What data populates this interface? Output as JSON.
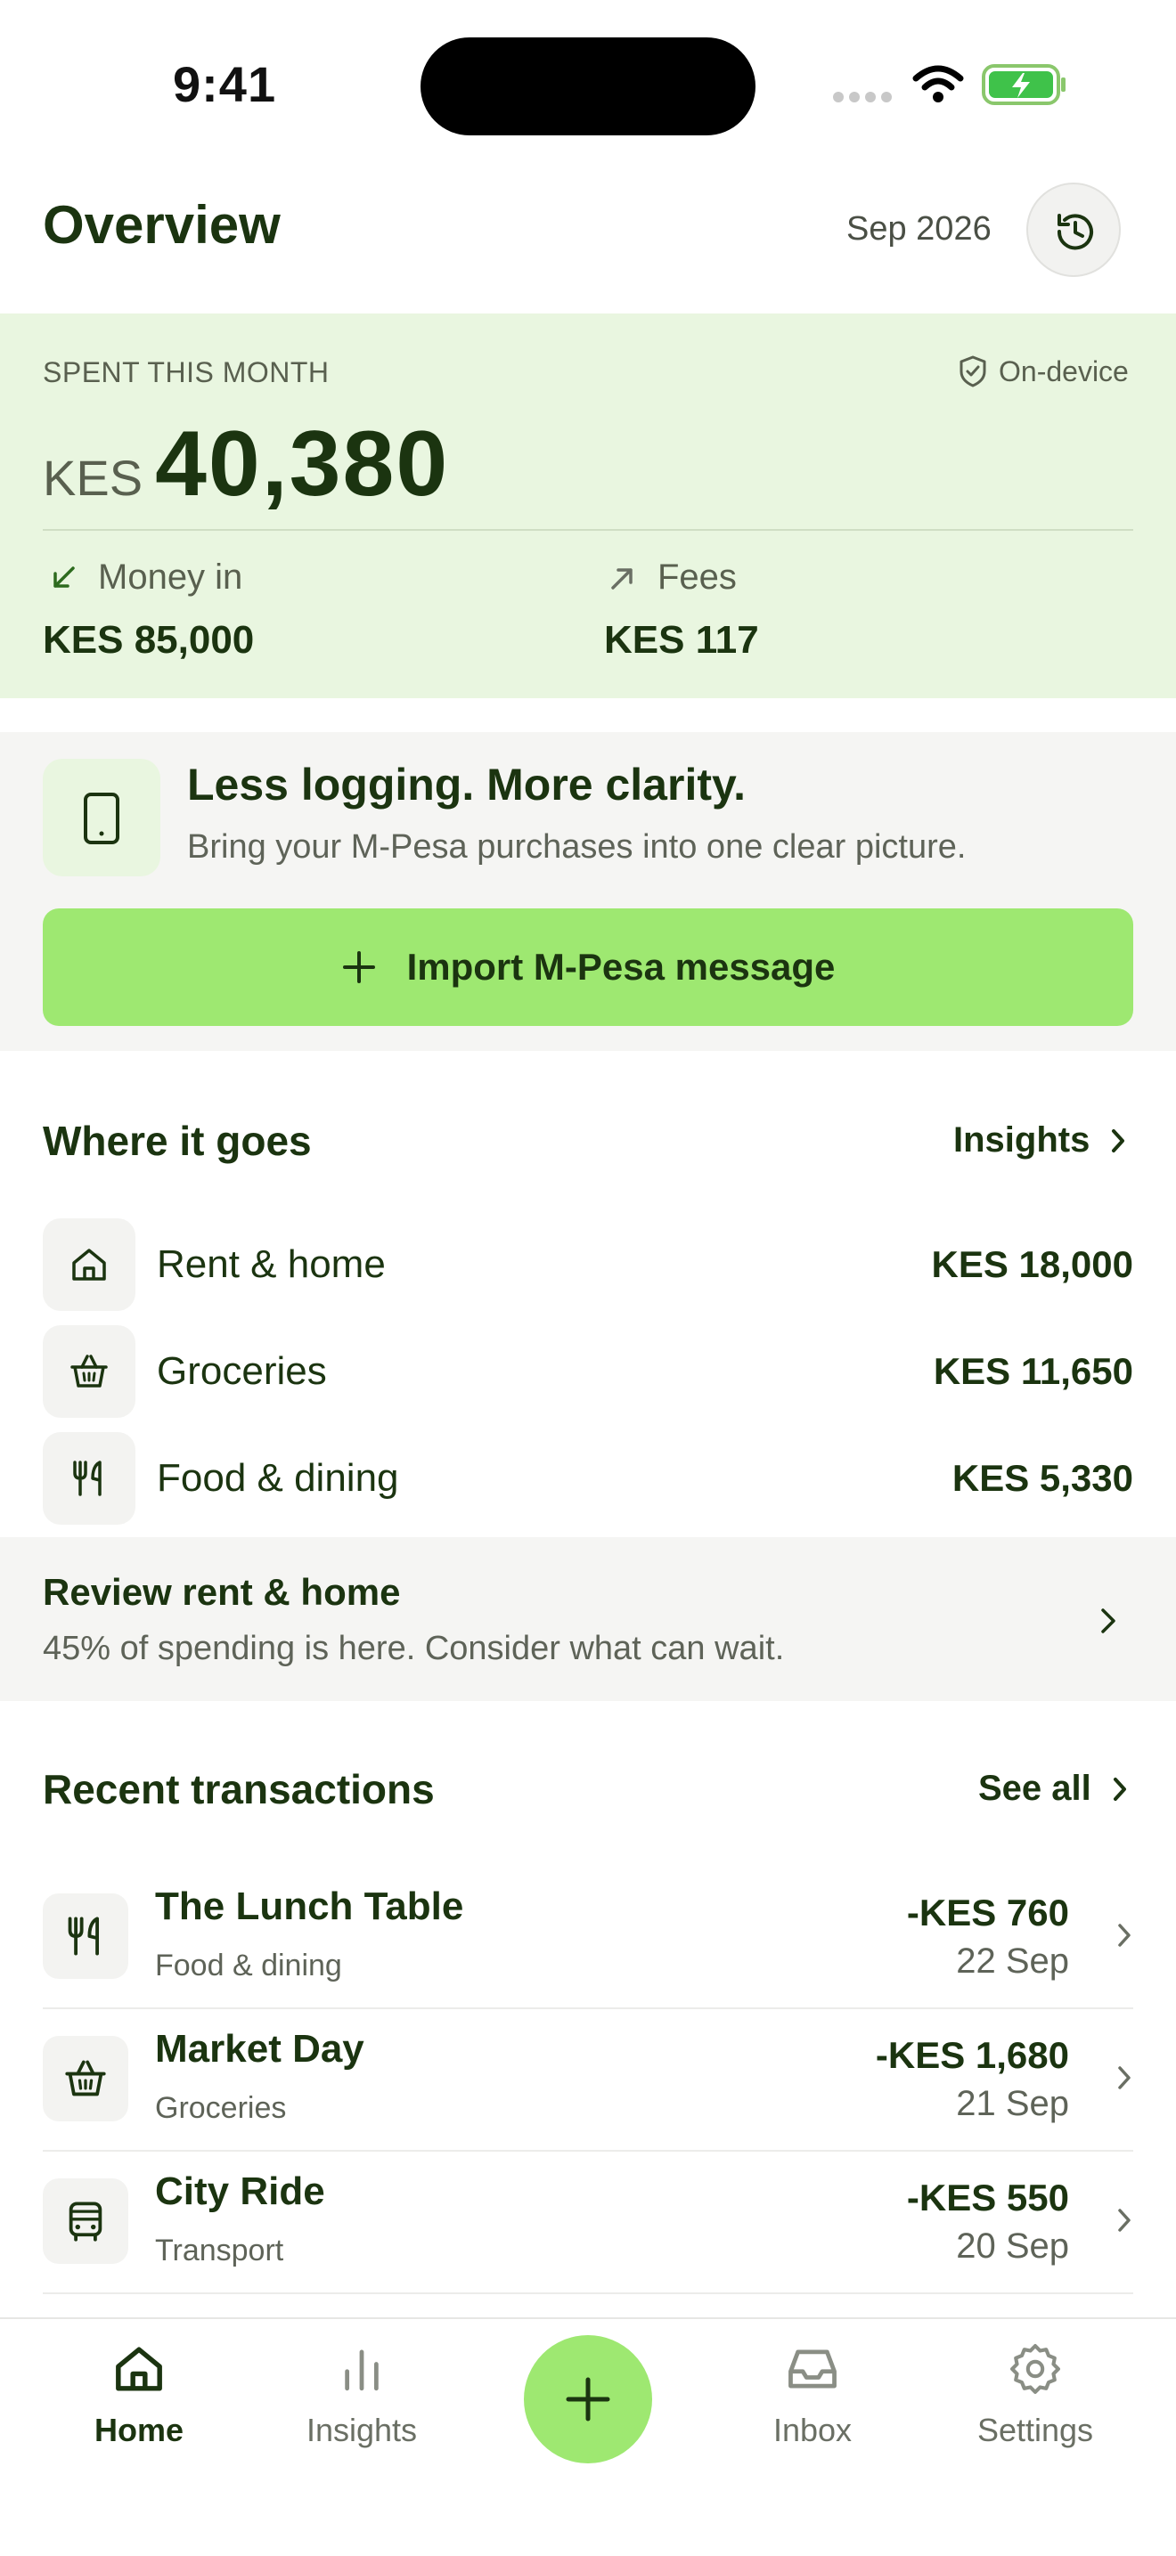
{
  "status_bar": {
    "time": "9:41"
  },
  "header": {
    "title": "Overview",
    "month": "Sep 2026",
    "history_icon": "history-icon"
  },
  "summary": {
    "label": "SPENT THIS MONTH",
    "badge": "On-device",
    "currency": "KES",
    "amount": "40,380",
    "money_in_label": "Money in",
    "money_in_value": "KES 85,000",
    "fees_label": "Fees",
    "fees_value": "KES 117"
  },
  "promo": {
    "title": "Less logging. More clarity.",
    "subtitle": "Bring your M-Pesa purchases into one clear picture.",
    "button_label": "Import M-Pesa message"
  },
  "where": {
    "title": "Where it goes",
    "link_label": "Insights",
    "categories": [
      {
        "icon": "home-icon",
        "name": "Rent & home",
        "amount": "KES 18,000"
      },
      {
        "icon": "basket-icon",
        "name": "Groceries",
        "amount": "KES 11,650"
      },
      {
        "icon": "utensils-icon",
        "name": "Food & dining",
        "amount": "KES 5,330"
      }
    ]
  },
  "review": {
    "title": "Review rent & home",
    "subtitle": "45% of spending is here. Consider what can wait."
  },
  "recent": {
    "title": "Recent transactions",
    "link_label": "See all",
    "items": [
      {
        "icon": "utensils-icon",
        "name": "The Lunch Table",
        "category": "Food & dining",
        "amount": "-KES 760",
        "date": "22 Sep"
      },
      {
        "icon": "basket-icon",
        "name": "Market Day",
        "category": "Groceries",
        "amount": "-KES 1,680",
        "date": "21 Sep"
      },
      {
        "icon": "bus-icon",
        "name": "City Ride",
        "category": "Transport",
        "amount": "-KES 550",
        "date": "20 Sep"
      }
    ]
  },
  "nav": {
    "active": "Home",
    "items": [
      {
        "icon": "home-icon",
        "label": "Home"
      },
      {
        "icon": "bar-chart-icon",
        "label": "Insights"
      },
      {
        "icon": "inbox-icon",
        "label": "Inbox"
      },
      {
        "icon": "gear-icon",
        "label": "Settings"
      }
    ]
  },
  "colors": {
    "accent": "#9ee871",
    "card_bg": "#e9f6e0",
    "text_dark": "#1b3410",
    "muted": "#5e6358",
    "panel": "#f5f5f3"
  }
}
